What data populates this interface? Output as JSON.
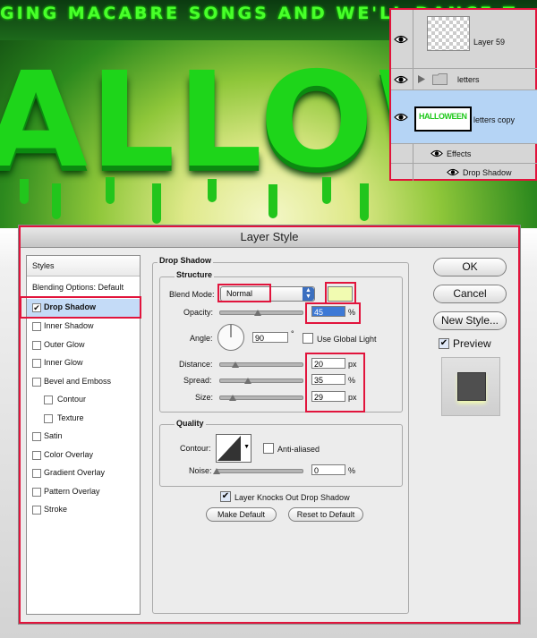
{
  "background": {
    "tagline": "GING MACABRE SONGS AND WE'LL DANCE T",
    "title_art": "ALLOWE"
  },
  "layers_panel": {
    "layers": [
      {
        "name": "Layer 59"
      },
      {
        "name": "letters"
      },
      {
        "name": "letters copy"
      }
    ],
    "effects_label": "Effects",
    "effect_item": "Drop Shadow",
    "thumb_text": "HALLOWEEN"
  },
  "dialog": {
    "title": "Layer Style",
    "styles_header": "Styles",
    "blending_options": "Blending Options: Default",
    "style_items": [
      {
        "label": "Drop Shadow",
        "checked": true
      },
      {
        "label": "Inner Shadow",
        "checked": false
      },
      {
        "label": "Outer Glow",
        "checked": false
      },
      {
        "label": "Inner Glow",
        "checked": false
      },
      {
        "label": "Bevel and Emboss",
        "checked": false
      },
      {
        "label": "Contour",
        "checked": false
      },
      {
        "label": "Texture",
        "checked": false
      },
      {
        "label": "Satin",
        "checked": false
      },
      {
        "label": "Color Overlay",
        "checked": false
      },
      {
        "label": "Gradient Overlay",
        "checked": false
      },
      {
        "label": "Pattern Overlay",
        "checked": false
      },
      {
        "label": "Stroke",
        "checked": false
      }
    ],
    "drop_shadow": {
      "section_title": "Drop Shadow",
      "structure_title": "Structure",
      "blend_mode_label": "Blend Mode:",
      "blend_mode_value": "Normal",
      "shadow_color": "#f1fbb1",
      "opacity_label": "Opacity:",
      "opacity_value": "45",
      "angle_label": "Angle:",
      "angle_value": "90",
      "angle_unit": "°",
      "use_global_light_label": "Use Global Light",
      "use_global_light": false,
      "distance_label": "Distance:",
      "distance_value": "20",
      "spread_label": "Spread:",
      "spread_value": "35",
      "size_label": "Size:",
      "size_value": "29",
      "px_unit": "px",
      "percent_unit": "%",
      "quality_title": "Quality",
      "contour_label": "Contour:",
      "anti_aliased_label": "Anti-aliased",
      "anti_aliased": false,
      "noise_label": "Noise:",
      "noise_value": "0",
      "knockout_label": "Layer Knocks Out Drop Shadow",
      "knockout": true,
      "make_default_label": "Make Default",
      "reset_default_label": "Reset to Default"
    },
    "buttons": {
      "ok": "OK",
      "cancel": "Cancel",
      "new_style": "New Style...",
      "preview_label": "Preview",
      "preview": true
    }
  }
}
